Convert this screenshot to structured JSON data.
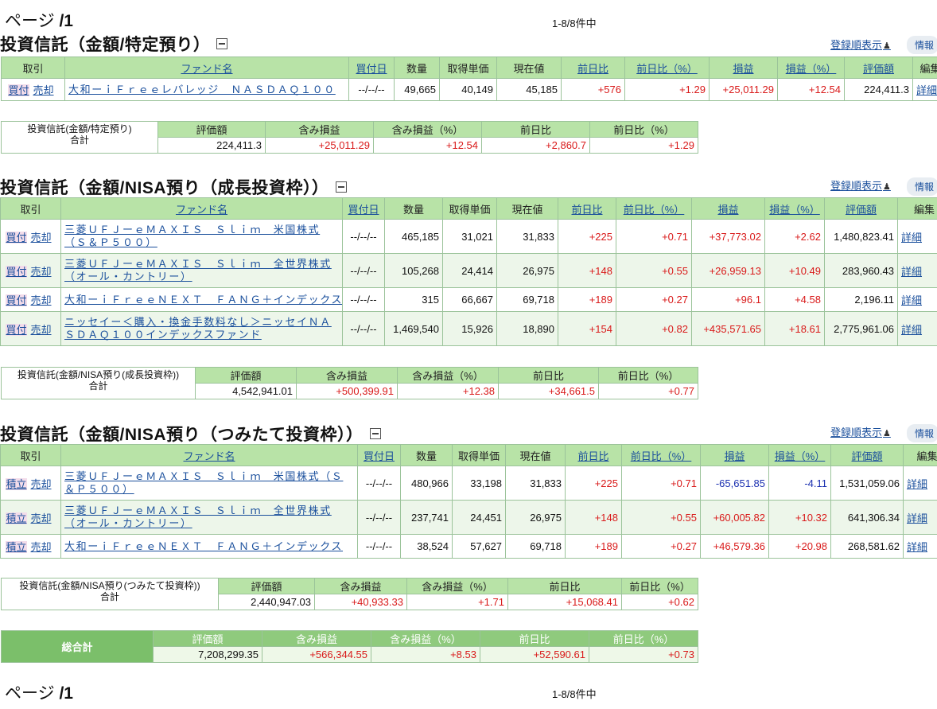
{
  "pagination_top": {
    "label": "ページ",
    "page": "/1",
    "range": "1-8/8件中"
  },
  "pagination_bottom": {
    "label": "ページ",
    "page": "/1",
    "range": "1-8/8件中"
  },
  "sections": [
    {
      "title": "投資信託（金額/特定預り）",
      "sort_link": "登録順表示",
      "info_button": "情報",
      "headers": [
        "取引",
        "ファンド名",
        "買付日",
        "数量",
        "取得単価",
        "現在値",
        "前日比",
        "前日比（%）",
        "損益",
        "損益（%）",
        "評価額",
        "編集"
      ],
      "rows": [
        {
          "buy": "買付",
          "sell": "売却",
          "fund": "大和ーｉＦｒｅｅレバレッジ　ＮＡＳＤＡＱ１００",
          "date": "--/--/--",
          "qty": "49,665",
          "unit_cost": "40,149",
          "price": "45,185",
          "day_change": "+576",
          "day_change_pct": "+1.29",
          "pnl": "+25,011.29",
          "pnl_pct": "+12.54",
          "value": "224,411.3",
          "detail": "詳細"
        }
      ],
      "summary": {
        "label_line1": "投資信託(金額/特定預り)",
        "label_line2": "合計",
        "headers": [
          "評価額",
          "含み損益",
          "含み損益（%）",
          "前日比",
          "前日比（%）"
        ],
        "values": [
          "224,411.3",
          "+25,011.29",
          "+12.54",
          "+2,860.7",
          "+1.29"
        ]
      }
    },
    {
      "title": "投資信託（金額/NISA預り（成長投資枠））",
      "sort_link": "登録順表示",
      "info_button": "情報",
      "headers": [
        "取引",
        "ファンド名",
        "買付日",
        "数量",
        "取得単価",
        "現在値",
        "前日比",
        "前日比（%）",
        "損益",
        "損益（%）",
        "評価額",
        "編集"
      ],
      "rows": [
        {
          "buy": "買付",
          "sell": "売却",
          "fund": "三菱ＵＦＪーｅＭＡＸＩＳ　Ｓｌｉｍ　米国株式（Ｓ＆Ｐ５００）",
          "date": "--/--/--",
          "qty": "465,185",
          "unit_cost": "31,021",
          "price": "31,833",
          "day_change": "+225",
          "day_change_pct": "+0.71",
          "pnl": "+37,773.02",
          "pnl_pct": "+2.62",
          "value": "1,480,823.41",
          "detail": "詳細"
        },
        {
          "buy": "買付",
          "sell": "売却",
          "fund": "三菱ＵＦＪーｅＭＡＸＩＳ　Ｓｌｉｍ　全世界株式（オール・カントリー）",
          "date": "--/--/--",
          "qty": "105,268",
          "unit_cost": "24,414",
          "price": "26,975",
          "day_change": "+148",
          "day_change_pct": "+0.55",
          "pnl": "+26,959.13",
          "pnl_pct": "+10.49",
          "value": "283,960.43",
          "detail": "詳細"
        },
        {
          "buy": "買付",
          "sell": "売却",
          "fund": "大和ーｉＦｒｅｅＮＥＸＴ　ＦＡＮＧ＋インデックス",
          "date": "--/--/--",
          "qty": "315",
          "unit_cost": "66,667",
          "price": "69,718",
          "day_change": "+189",
          "day_change_pct": "+0.27",
          "pnl": "+96.1",
          "pnl_pct": "+4.58",
          "value": "2,196.11",
          "detail": "詳細"
        },
        {
          "buy": "買付",
          "sell": "売却",
          "fund": "ニッセイー＜購入・換金手数料なし＞ニッセイＮＡＳＤＡＱ１００インデックスファンド",
          "date": "--/--/--",
          "qty": "1,469,540",
          "unit_cost": "15,926",
          "price": "18,890",
          "day_change": "+154",
          "day_change_pct": "+0.82",
          "pnl": "+435,571.65",
          "pnl_pct": "+18.61",
          "value": "2,775,961.06",
          "detail": "詳細"
        }
      ],
      "summary": {
        "label_line1": "投資信託(金額/NISA預り(成長投資枠))",
        "label_line2": "合計",
        "headers": [
          "評価額",
          "含み損益",
          "含み損益（%）",
          "前日比",
          "前日比（%）"
        ],
        "values": [
          "4,542,941.01",
          "+500,399.91",
          "+12.38",
          "+34,661.5",
          "+0.77"
        ]
      }
    },
    {
      "title": "投資信託（金額/NISA預り（つみたて投資枠））",
      "sort_link": "登録順表示",
      "info_button": "情報",
      "headers": [
        "取引",
        "ファンド名",
        "買付日",
        "数量",
        "取得単価",
        "現在値",
        "前日比",
        "前日比（%）",
        "損益",
        "損益（%）",
        "評価額",
        "編集"
      ],
      "rows": [
        {
          "buy": "積立",
          "sell": "売却",
          "fund": "三菱ＵＦＪーｅＭＡＸＩＳ　Ｓｌｉｍ　米国株式（Ｓ＆Ｐ５００）",
          "date": "--/--/--",
          "qty": "480,966",
          "unit_cost": "33,198",
          "price": "31,833",
          "day_change": "+225",
          "day_change_pct": "+0.71",
          "pnl": "-65,651.85",
          "pnl_pct": "-4.11",
          "value": "1,531,059.06",
          "detail": "詳細"
        },
        {
          "buy": "積立",
          "sell": "売却",
          "fund": "三菱ＵＦＪーｅＭＡＸＩＳ　Ｓｌｉｍ　全世界株式（オール・カントリー）",
          "date": "--/--/--",
          "qty": "237,741",
          "unit_cost": "24,451",
          "price": "26,975",
          "day_change": "+148",
          "day_change_pct": "+0.55",
          "pnl": "+60,005.82",
          "pnl_pct": "+10.32",
          "value": "641,306.34",
          "detail": "詳細"
        },
        {
          "buy": "積立",
          "sell": "売却",
          "fund": "大和ーｉＦｒｅｅＮＥＸＴ　ＦＡＮＧ＋インデックス",
          "date": "--/--/--",
          "qty": "38,524",
          "unit_cost": "57,627",
          "price": "69,718",
          "day_change": "+189",
          "day_change_pct": "+0.27",
          "pnl": "+46,579.36",
          "pnl_pct": "+20.98",
          "value": "268,581.62",
          "detail": "詳細"
        }
      ],
      "summary": {
        "label_line1": "投資信託(金額/NISA預り(つみたて投資枠))",
        "label_line2": "合計",
        "headers": [
          "評価額",
          "含み損益",
          "含み損益（%）",
          "前日比",
          "前日比（%）"
        ],
        "values": [
          "2,440,947.03",
          "+40,933.33",
          "+1.71",
          "+15,068.41",
          "+0.62"
        ]
      }
    }
  ],
  "grand_total": {
    "label": "総合計",
    "headers": [
      "評価額",
      "含み損益",
      "含み損益（%）",
      "前日比",
      "前日比（%）"
    ],
    "values": [
      "7,208,299.35",
      "+566,344.55",
      "+8.53",
      "+52,590.61",
      "+0.73"
    ]
  },
  "colors": {
    "header_green": "#b8e3a7",
    "row_alt": "#edf6ea",
    "positive": "#d91a1a",
    "negative": "#1a2fb0",
    "link": "#1a4f9c"
  },
  "icons": {
    "collapse": "minus-square-icon",
    "person": "person-icon"
  }
}
